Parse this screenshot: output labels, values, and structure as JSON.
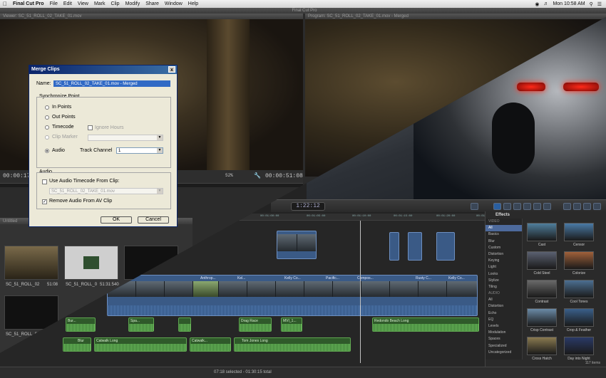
{
  "menubar": {
    "apple": "",
    "app": "Final Cut Pro",
    "items": [
      "File",
      "Edit",
      "View",
      "Mark",
      "Clip",
      "Modify",
      "Share",
      "Window",
      "Help"
    ],
    "clock": "Mon 10:58 AM"
  },
  "fcp7": {
    "window_title": "Final Cut Pro",
    "viewer_title": "Viewer: SC_51_ROLL_02_TAKE_01.mov",
    "canvas_title": "Program: SC_51_ROLL_02_TAKE_01.mov - Merged",
    "viewer_tc_left": "00:00:17",
    "viewer_zoom": "52%",
    "viewer_tc_right": "00:00:51:08",
    "browser_title": "Untitled",
    "browser_tabs": [
      "Untitled",
      "Effects"
    ],
    "thumbs": [
      {
        "label": "SC_51_ROLL_02",
        "dur": "51:08"
      },
      {
        "label": "SC_51_ROLL_0",
        "dur": "51:31:540"
      },
      {
        "label": ""
      },
      {
        "label": "SC_51_ROLL_02_TAK"
      }
    ]
  },
  "dialog": {
    "title": "Merge Clips",
    "close": "x",
    "name_label": "Name:",
    "name_value": "SC_51_ROLL_02_TAKE_01.mov - Merged",
    "sync_header": "Synchronize Point",
    "opt_in": "In Points",
    "opt_out": "Out Points",
    "opt_tc": "Timecode",
    "opt_ignore_hours": "Ignore Hours",
    "opt_clip_marker": "Clip Marker",
    "opt_audio": "Audio",
    "track_channel_label": "Track Channel",
    "track_channel_value": "1",
    "audio_header": "Audio",
    "use_audio_tc": "Use Audio Timecode From Clip:",
    "audio_clip_value": "SC_51_ROLL_02_TAKE_01.mov",
    "remove_audio": "Remove Audio From AV Clip",
    "ok": "OK",
    "cancel": "Cancel"
  },
  "fcpx": {
    "timecode": "1:22:12",
    "ruler_ticks": [
      "00:01:00:00",
      "00:01:05:00",
      "00:01:10:00",
      "00:01:15:00",
      "00:01:20:00",
      "00:01:25:00"
    ],
    "video_clips": [
      {
        "label": "Anthrop...",
        "name": "clip"
      },
      {
        "label": "Kel...",
        "name": "clip"
      },
      {
        "label": "Kelly Co...",
        "name": "clip"
      },
      {
        "label": "Pacific...",
        "name": "clip"
      },
      {
        "label": "Compos...",
        "name": "clip"
      },
      {
        "label": "Rusty C...",
        "name": "clip"
      },
      {
        "label": "Kelly Co...",
        "name": "clip"
      }
    ],
    "audio_clips": [
      "Bur...",
      "Catwalk Long",
      "Catwalk...",
      "Drag Race",
      "MVI_1...",
      "Spa...",
      "Tom Jones Long",
      "Redondo Beach Long",
      "Blur"
    ],
    "status": "07:18 selected - 01:30:15 total"
  },
  "effects": {
    "title": "Effects",
    "categories": [
      {
        "label": "VIDEO",
        "hdr": true
      },
      {
        "label": "All",
        "sel": true
      },
      {
        "label": "Basics"
      },
      {
        "label": "Blur"
      },
      {
        "label": "Custom"
      },
      {
        "label": "Distortion"
      },
      {
        "label": "Keying"
      },
      {
        "label": "Light"
      },
      {
        "label": "Looks"
      },
      {
        "label": "Stylize"
      },
      {
        "label": "Tiling"
      },
      {
        "label": "AUDIO",
        "hdr": true
      },
      {
        "label": "All"
      },
      {
        "label": "Distortion"
      },
      {
        "label": "Echo"
      },
      {
        "label": "EQ"
      },
      {
        "label": "Levels"
      },
      {
        "label": "Modulation"
      },
      {
        "label": "Spaces"
      },
      {
        "label": "Specialized"
      },
      {
        "label": "Uncategorized"
      }
    ],
    "tiles": [
      "Cast",
      "Censor",
      "Cold Steel",
      "Colorize",
      "Contrast",
      "Cool Tones",
      "Crisp Contrast",
      "Crop & Feather",
      "Cross Hatch",
      "Day into Night"
    ],
    "tile_colors": [
      "#4f7e9c",
      "#4a7aa6",
      "#5a6070",
      "#a0603a",
      "#6a6a6a",
      "#4c6f92",
      "#6a8aa6",
      "#3a5f8a",
      "#8a7a50",
      "#2a3a66"
    ],
    "count": "117 items"
  }
}
